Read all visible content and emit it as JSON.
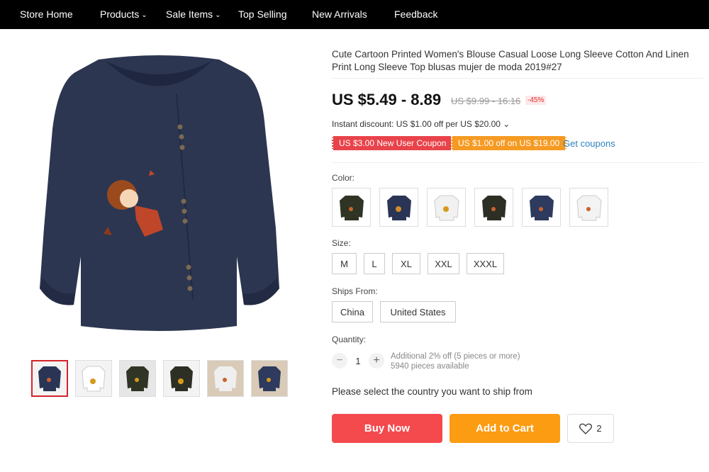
{
  "nav": {
    "items": [
      {
        "label": "Store Home"
      },
      {
        "label": "Products",
        "has_dropdown": true
      },
      {
        "label": "Sale Items",
        "has_dropdown": true
      },
      {
        "label": "Top Selling"
      },
      {
        "label": "New Arrivals"
      },
      {
        "label": "Feedback"
      }
    ]
  },
  "product": {
    "title": "Cute Cartoon Printed Women's Blouse Casual Loose Long Sleeve Cotton And Linen Print Long Sleeve Top blusas mujer de moda 2019#27",
    "price_range": "US $5.49 - 8.89",
    "original_price": "US $9.99 - 16.16",
    "discount": "-45%",
    "instant_discount": "Instant discount: US $1.00 off per US $20.00 ⌄",
    "coupons": [
      "US $3.00 New User Coupon",
      "US $1.00 off on US $19.00"
    ],
    "get_coupons": "Get coupons",
    "color_label": "Color:",
    "colors": [
      {
        "shirt": "#2f3424",
        "art": "#c9622e"
      },
      {
        "shirt": "#2a3556",
        "art": "#d68a2a"
      },
      {
        "shirt": "#f1f1f1",
        "art": "#d69a1c"
      },
      {
        "shirt": "#2d2f25",
        "art": "#c9622e"
      },
      {
        "shirt": "#2e3a5e",
        "art": "#c9622e"
      },
      {
        "shirt": "#f3f3f3",
        "art": "#c9622e"
      }
    ],
    "size_label": "Size:",
    "sizes": [
      "M",
      "L",
      "XL",
      "XXL",
      "XXXL"
    ],
    "ships_label": "Ships From:",
    "ships_from": [
      "China",
      "United States"
    ],
    "quantity_label": "Quantity:",
    "quantity": "1",
    "qty_minus": "−",
    "qty_plus": "+",
    "additional_off": "Additional 2% off (5 pieces or more)",
    "available": "5940 pieces available",
    "ship_note": "Please select the country you want to ship from",
    "buy_now": "Buy Now",
    "add_to_cart": "Add to Cart",
    "wishlist_count": "2"
  },
  "thumbnails": [
    {
      "shirt": "#2a3556",
      "bg": "#f3f3f3"
    },
    {
      "shirt": "#f1f1f1",
      "bg": "#f3f3f3"
    },
    {
      "shirt": "#2f3424",
      "bg": "#e6e6e6"
    },
    {
      "shirt": "#2d2f25",
      "bg": "#f3f3f3"
    },
    {
      "shirt": "#efefef",
      "bg": "#d9cbb7"
    },
    {
      "shirt": "#2e3a5e",
      "bg": "#d9cbb7"
    }
  ],
  "colors": {
    "nav_bg": "#000000",
    "price_red": "#e62e2e",
    "buy_now": "#f44a4e",
    "add_to_cart": "#fb9c13",
    "link": "#2b82bf",
    "main_shirt": "#2c3650"
  }
}
